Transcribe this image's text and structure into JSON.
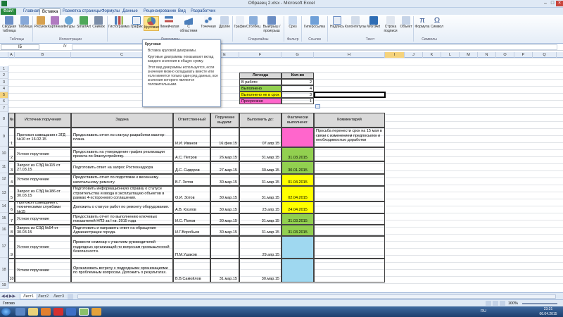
{
  "title": "Образец 2.xlsx - Microsoft Excel",
  "tabs": [
    "Файл",
    "Главная",
    "Вставка",
    "Разметка страницы",
    "Формулы",
    "Данные",
    "Рецензирование",
    "Вид",
    "Разработчик"
  ],
  "ribbon": {
    "buttons": [
      "Сводная таблица",
      "Таблица",
      "Рисунок",
      "Картинка",
      "Фигуры",
      "SmartArt",
      "Снимок",
      "Гистограмма",
      "График",
      "Круговая",
      "Линейчатая",
      "С областями",
      "Точечная",
      "Другие",
      "График",
      "Столбец",
      "Выигрыш / проигрыш",
      "Срез",
      "Гиперссылка",
      "Надпись",
      "Колонтитулы",
      "WordArt",
      "Строка подписи",
      "Объект",
      "Формула",
      "Символ"
    ],
    "groups": [
      "Таблицы",
      "Иллюстрации",
      "Диаграммы",
      "Спарклайны",
      "Фильтр",
      "Ссылки",
      "Текст",
      "Символы"
    ]
  },
  "formula_bar": {
    "name_box": "I5",
    "fx": "fx",
    "value": ""
  },
  "columns": [
    "A",
    "B",
    "C",
    "D",
    "E",
    "F",
    "G",
    "H",
    "I",
    "J",
    "K",
    "L",
    "M",
    "N",
    "O",
    "P",
    "Q"
  ],
  "rows": [
    "1",
    "2",
    "3",
    "4",
    "5",
    "6",
    "7",
    "8",
    "9",
    "10",
    "11",
    "12",
    "13",
    "14",
    "15",
    "16",
    "17",
    "18",
    "19"
  ],
  "tooltip": {
    "title": "Круговая",
    "line1": "Вставка круговой диаграммы.",
    "line2": "Круговые диаграммы показывают вклад каждого значения в общую сумму.",
    "line3": "Этот вид диаграммы используется, если значения можно складывать вместе или если имеется только один ряд данных, все значения которого являются положительными."
  },
  "legend": {
    "header": [
      "Легенда",
      "Кол-во"
    ],
    "rows": [
      {
        "label": "В работе",
        "value": "2",
        "color": "#ffffff"
      },
      {
        "label": "Выполнено",
        "value": "4",
        "color": "#92d050"
      },
      {
        "label": "Выполнено не в срок",
        "value": "3",
        "color": "#ffff00"
      },
      {
        "label": "Просрочено",
        "value": "1",
        "color": "#ff66cc"
      }
    ]
  },
  "table": {
    "headers": [
      "№",
      "Источник поручения",
      "Задача",
      "Ответственный",
      "Поручение выдали:",
      "Выполнить до:",
      "Фактически выполнено:",
      "Комментарий"
    ],
    "rows": [
      {
        "n": "1",
        "src": "Протокол совещания г ЗГД №10 от 16.02.15",
        "task": "Предоставить отчет по статусу разработки мастер-плана.",
        "resp": "И.И. Иванов",
        "given": "16.фев.15",
        "due": "07.апр.15",
        "done": "",
        "color": "#ff66cc",
        "comment": "Просьба перенести срок на 15 мая в связи с изменением предпосылок и необходимостью доработки"
      },
      {
        "n": "2",
        "src": "Устное поручение",
        "task": "Предоставить на утверждение график реализации проекта по благоустройству.",
        "resp": "А.С. Петров",
        "given": "26.мар.15",
        "due": "31.мар.15",
        "done": "31.03.2015",
        "color": "#92d050",
        "comment": ""
      },
      {
        "n": "3",
        "src": "Запрос из СЭД №115 от 27.03.15",
        "task": "Подготовить ответ на запрос Ростехнадзора",
        "resp": "Д.С. Сидоров",
        "given": "27.мар.15",
        "due": "30.мар.15",
        "done": "30.01.2015",
        "color": "#92d050",
        "comment": ""
      },
      {
        "n": "4",
        "src": "Устное поручение",
        "task": "Предоставить отчет по подготовке к весеннему капитальному ремонту.",
        "resp": "В.Г. Зотов",
        "given": "30.мар.15",
        "due": "31.мар.15",
        "done": "01.04.2015",
        "color": "#ffff00",
        "comment": ""
      },
      {
        "n": "5",
        "src": "Запрос из СЭД №186 от 30.03.15",
        "task": "Подготовить информационную справку о статусе строительства и ввода в эксплуатацию объектов в рамках 4-хсторонного соглашения.",
        "resp": "О.И. Зотов",
        "given": "30.мар.15",
        "due": "31.мар.15",
        "done": "02.04.2015",
        "color": "#ffff00",
        "comment": ""
      },
      {
        "n": "6",
        "src": "Протокол совещания с техническими службами №15",
        "task": "Доложить о статусе работ по ремонту оборудования.",
        "resp": "А.В. Козлов",
        "given": "30.мар.15",
        "due": "23.апр.15",
        "done": "24.04.2015",
        "color": "#ffff00",
        "comment": ""
      },
      {
        "n": "7",
        "src": "Устное поручение",
        "task": "Предоставить отчет по выполнению ключевых показателей НПЗ за I кв. 2015 года",
        "resp": "И.С. Попов",
        "given": "30.мар.15",
        "due": "31.мар.15",
        "done": "31.03.2015",
        "color": "#92d050",
        "comment": ""
      },
      {
        "n": "8",
        "src": "Запрос из СЭД №54 от 30.03.15",
        "task": "Подготовить и направить ответ на обращение Администрации города.",
        "resp": "И.Г.Воробьев",
        "given": "30.мар.15",
        "due": "31.мар.15",
        "done": "31.03.2015",
        "color": "#92d050",
        "comment": ""
      },
      {
        "n": "9",
        "src": "Устное поручение",
        "task": "Провести семинар с участием руководителей подрядных организаций по вопросам промышленной безопасности.",
        "resp": "П.М.Ушаков",
        "given": "",
        "due": "29.апр.15",
        "done": "",
        "color": "#9fd8f0",
        "comment": ""
      },
      {
        "n": "10",
        "src": "Устное поручение",
        "task": "Организовать встречу с подрядными организациями по проблемным вопросам. Доложить о результатах.",
        "resp": "В.В.Самойлов",
        "given": "31.мар.15",
        "due": "30.мар.15",
        "done": "",
        "color": "#9fd8f0",
        "comment": ""
      }
    ]
  },
  "sheets": [
    "Лист1",
    "Лист2",
    "Лист3"
  ],
  "status": {
    "ready": "Готово",
    "zoom": "100%"
  },
  "taskbar": {
    "lang": "RU",
    "time": "23:31",
    "date": "06.04.2015"
  }
}
